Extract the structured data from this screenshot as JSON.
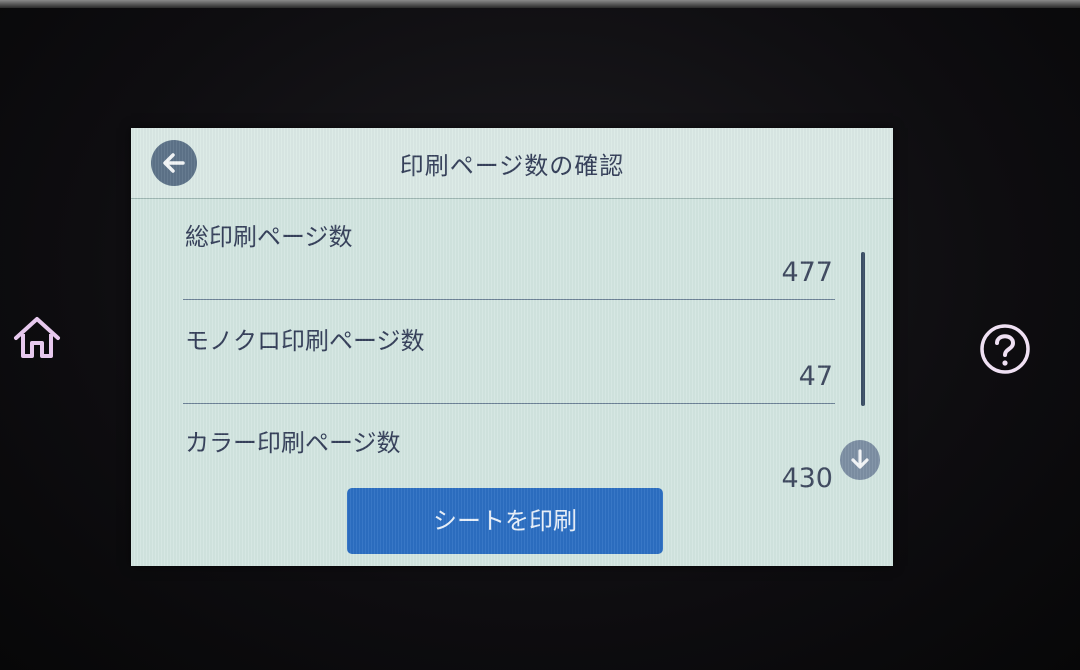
{
  "device": {
    "home_icon": "home-icon",
    "help_icon": "question-mark-icon"
  },
  "screen": {
    "title": "印刷ページ数の確認",
    "back_icon": "arrow-left-icon"
  },
  "counts": [
    {
      "label": "総印刷ページ数",
      "value": "477"
    },
    {
      "label": "モノクロ印刷ページ数",
      "value": "47"
    },
    {
      "label": "カラー印刷ページ数",
      "value": "430"
    }
  ],
  "scroll": {
    "down_icon": "arrow-down-icon"
  },
  "actions": {
    "print_sheet_label": "シートを印刷"
  },
  "colors": {
    "screen_bg": "#d3e6e1",
    "button_blue": "#2c6fc2",
    "text": "#35405a"
  }
}
